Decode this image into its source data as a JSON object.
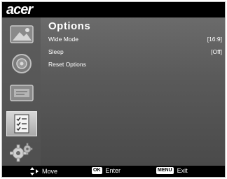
{
  "brand": {
    "logo_text": "acer"
  },
  "sidebar": {
    "items": [
      {
        "name": "picture",
        "icon": "picture-icon"
      },
      {
        "name": "audio",
        "icon": "speaker-icon"
      },
      {
        "name": "adjust",
        "icon": "display-settings-icon"
      },
      {
        "name": "options",
        "icon": "checklist-icon",
        "active": true
      },
      {
        "name": "management",
        "icon": "gears-icon"
      }
    ]
  },
  "menu": {
    "title": "Options",
    "items": [
      {
        "label": "Wide Mode",
        "value": "[16:9]"
      },
      {
        "label": "Sleep",
        "value": "[Off]"
      },
      {
        "label": "Reset Options",
        "value": ""
      }
    ]
  },
  "footer": {
    "move_label": "Move",
    "ok_badge": "OK",
    "enter_label": "Enter",
    "menu_badge": "MENU",
    "exit_label": "Exit"
  }
}
